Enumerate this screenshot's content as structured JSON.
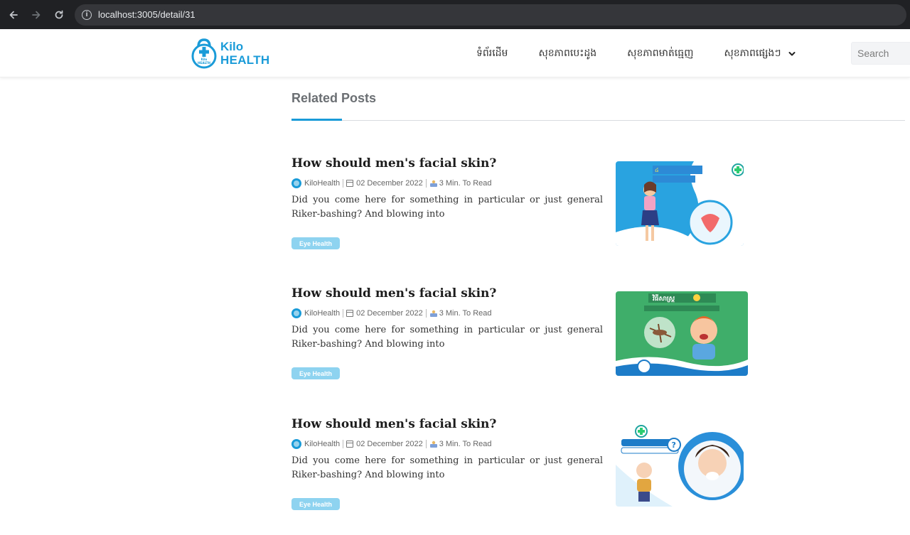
{
  "browser": {
    "url": "localhost:3005/detail/31",
    "back_icon": "back-arrow-icon",
    "forward_icon": "forward-arrow-icon",
    "reload_icon": "reload-icon"
  },
  "header": {
    "logo": {
      "line1": "Kilo",
      "line2": "HEALTH",
      "mark_text": "Kilo\nHEALTH"
    },
    "nav": [
      {
        "label": "ទំព័រដើម"
      },
      {
        "label": "សុខភាពបេះដូង"
      },
      {
        "label": "សុខភាពមាត់ធ្មេញ"
      },
      {
        "label": "សុខភាពផ្សេងៗ",
        "has_dropdown": true
      }
    ],
    "search": {
      "placeholder": "Search"
    }
  },
  "related": {
    "title": "Related Posts",
    "posts": [
      {
        "title": "How should men's facial skin?",
        "author": "KiloHealth",
        "date": "02 December 2022",
        "read_time": "3 Min. To Read",
        "excerpt": "Did you come here for something in particular or just general Riker-bashing? And blowing into",
        "tag": "Eye Health"
      },
      {
        "title": "How should men's facial skin?",
        "author": "KiloHealth",
        "date": "02 December 2022",
        "read_time": "3 Min. To Read",
        "excerpt": "Did you come here for something in particular or just general Riker-bashing? And blowing into",
        "tag": "Eye Health"
      },
      {
        "title": "How should men's facial skin?",
        "author": "KiloHealth",
        "date": "02 December 2022",
        "read_time": "3 Min. To Read",
        "excerpt": "Did you come here for something in particular or just general Riker-bashing? And blowing into",
        "tag": "Eye Health"
      }
    ]
  },
  "colors": {
    "brand": "#1a9bd8",
    "tag_bg": "#8ed3f0",
    "chrome_bg": "#202124"
  }
}
